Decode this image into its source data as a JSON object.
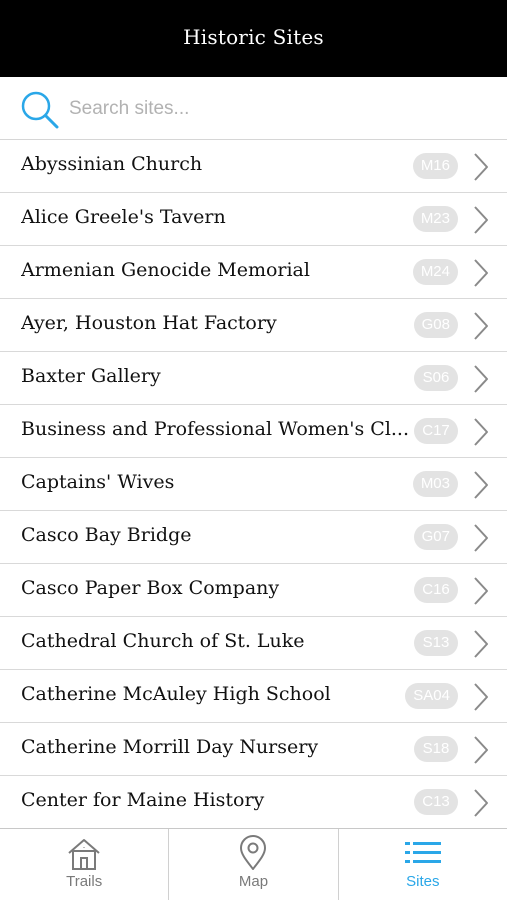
{
  "header": {
    "title": "Historic Sites"
  },
  "search": {
    "placeholder": "Search sites...",
    "value": ""
  },
  "colors": {
    "accent": "#2aa7e8",
    "badge": "#e3e3e3",
    "header_bg": "#000000"
  },
  "sites": [
    {
      "name": "Abyssinian Church",
      "code": "M16"
    },
    {
      "name": "Alice Greele's Tavern",
      "code": "M23"
    },
    {
      "name": "Armenian Genocide Memorial",
      "code": "M24"
    },
    {
      "name": "Ayer, Houston Hat Factory",
      "code": "G08"
    },
    {
      "name": "Baxter Gallery",
      "code": "S06"
    },
    {
      "name": "Business and Professional Women's Cl...",
      "code": "C17"
    },
    {
      "name": "Captains' Wives",
      "code": "M03"
    },
    {
      "name": "Casco Bay Bridge",
      "code": "G07"
    },
    {
      "name": "Casco Paper Box Company",
      "code": "C16"
    },
    {
      "name": "Cathedral Church of St. Luke",
      "code": "S13"
    },
    {
      "name": "Catherine McAuley High School",
      "code": "SA04"
    },
    {
      "name": "Catherine Morrill Day Nursery",
      "code": "S18"
    },
    {
      "name": "Center for Maine History",
      "code": "C13"
    }
  ],
  "tabs": [
    {
      "label": "Trails",
      "icon": "house-icon",
      "active": false
    },
    {
      "label": "Map",
      "icon": "map-pin-icon",
      "active": false
    },
    {
      "label": "Sites",
      "icon": "list-icon",
      "active": true
    }
  ]
}
